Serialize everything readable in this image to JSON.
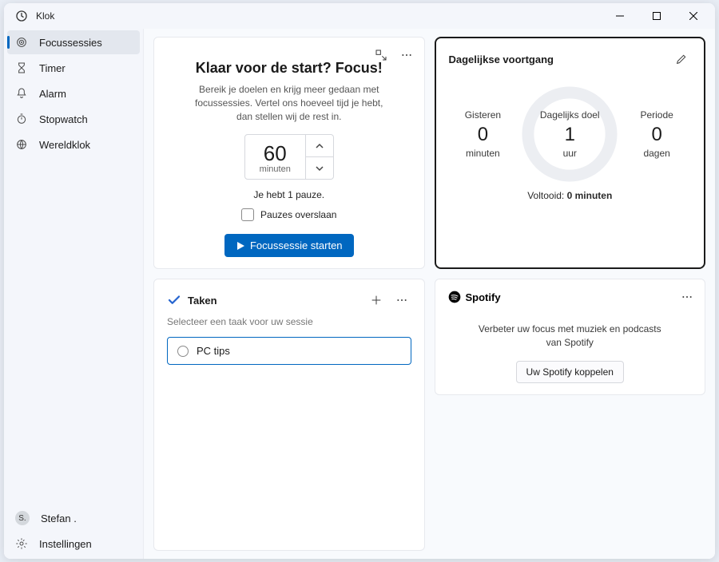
{
  "window": {
    "title": "Klok"
  },
  "sidebar": {
    "items": [
      {
        "label": "Focussessies"
      },
      {
        "label": "Timer"
      },
      {
        "label": "Alarm"
      },
      {
        "label": "Stopwatch"
      },
      {
        "label": "Wereldklok"
      }
    ],
    "user_initial": "S.",
    "user_name": "Stefan .",
    "settings_label": "Instellingen"
  },
  "focus": {
    "title": "Klaar voor de start? Focus!",
    "subtitle": "Bereik je doelen en krijg meer gedaan met focussessies. Vertel ons hoeveel tijd je hebt, dan stellen wij de rest in.",
    "minutes_value": "60",
    "minutes_unit": "minuten",
    "pause_text": "Je hebt 1 pauze.",
    "skip_label": "Pauzes overslaan",
    "start_button": "Focussessie starten"
  },
  "progress": {
    "title": "Dagelijkse voortgang",
    "yesterday_label": "Gisteren",
    "yesterday_value": "0",
    "yesterday_unit": "minuten",
    "goal_label": "Dagelijks doel",
    "goal_value": "1",
    "goal_unit": "uur",
    "streak_label": "Periode",
    "streak_value": "0",
    "streak_unit": "dagen",
    "completed_label": "Voltooid:",
    "completed_value": "0 minuten"
  },
  "spotify": {
    "brand": "Spotify",
    "desc": "Verbeter uw focus met muziek en podcasts van Spotify",
    "link_button": "Uw Spotify koppelen"
  },
  "tasks": {
    "title": "Taken",
    "subtitle": "Selecteer een taak voor uw sessie",
    "items": [
      {
        "label": "PC tips"
      }
    ]
  }
}
